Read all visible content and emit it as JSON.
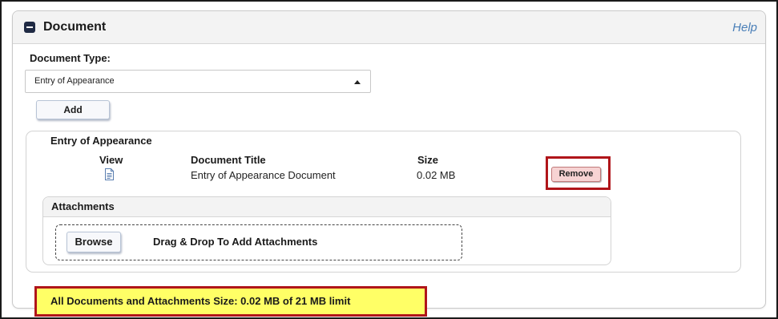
{
  "panel": {
    "title": "Document",
    "help_label": "Help"
  },
  "document_type": {
    "label": "Document Type:",
    "selected": "Entry of Appearance"
  },
  "add_button_label": "Add",
  "document": {
    "name": "Entry of Appearance",
    "columns": {
      "view": "View",
      "title": "Document Title",
      "size": "Size"
    },
    "row": {
      "title": "Entry of Appearance Document",
      "size": "0.02  MB",
      "view_icon": "document-icon"
    },
    "remove_label": "Remove"
  },
  "attachments": {
    "title": "Attachments",
    "browse_label": "Browse",
    "drop_text": "Drag & Drop To Add Attachments"
  },
  "total": {
    "text": "All Documents and Attachments Size: 0.02 MB of 21 MB limit"
  },
  "colors": {
    "highlight_border": "#b0151a",
    "total_background": "#ffff66",
    "help_link": "#4a7fb8",
    "remove_background": "#f7d3d3"
  }
}
